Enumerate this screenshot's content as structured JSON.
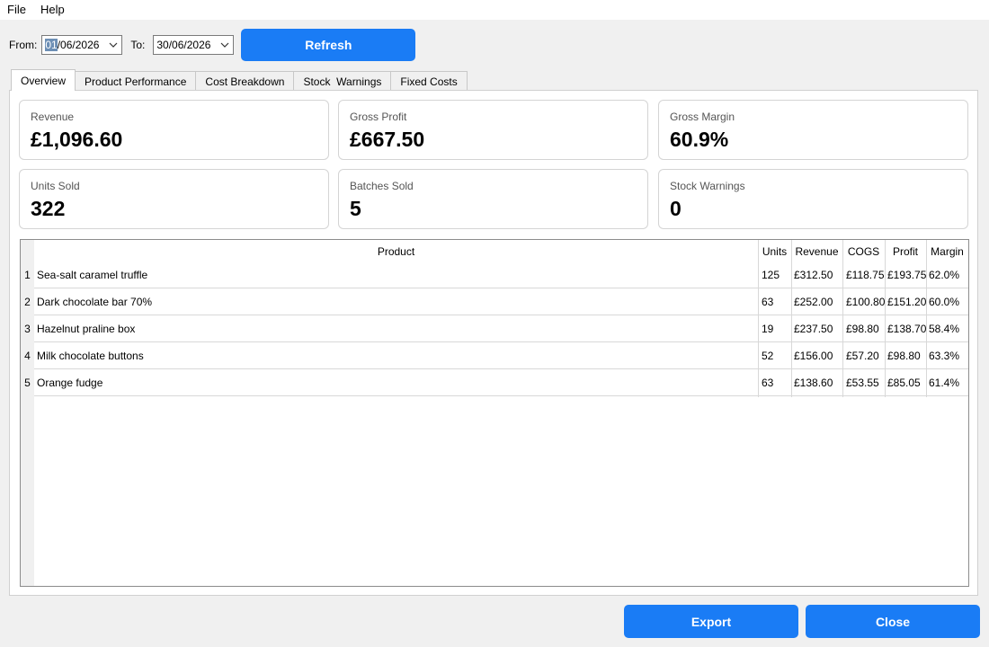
{
  "menu": [
    "File",
    "Help"
  ],
  "filters": {
    "from_label": "From:",
    "from_value_selected": "01",
    "from_value_rest": "/06/2026",
    "to_label": "To:",
    "to_value": "30/06/2026"
  },
  "refresh_label": "Refresh",
  "tabs": [
    "Overview",
    "Product Performance",
    "Cost Breakdown",
    "Stock  Warnings",
    "Fixed Costs"
  ],
  "active_tab": "Overview",
  "cards": [
    {
      "title": "Revenue",
      "value": "£1,096.60"
    },
    {
      "title": "Gross Profit",
      "value": "£667.50"
    },
    {
      "title": "Gross Margin",
      "value": "60.9%"
    },
    {
      "title": "Units Sold",
      "value": "322"
    },
    {
      "title": "Batches Sold",
      "value": "5"
    },
    {
      "title": "Stock Warnings",
      "value": "0"
    }
  ],
  "table": {
    "headers": [
      "Product",
      "Units",
      "Revenue",
      "COGS",
      "Profit",
      "Margin"
    ],
    "rows": [
      {
        "num": "1",
        "product": "Sea-salt caramel truffle",
        "units": "125",
        "revenue": "£312.50",
        "cogs": "£118.75",
        "profit": "£193.75",
        "margin": "62.0%"
      },
      {
        "num": "2",
        "product": "Dark chocolate bar 70%",
        "units": "63",
        "revenue": "£252.00",
        "cogs": "£100.80",
        "profit": "£151.20",
        "margin": "60.0%"
      },
      {
        "num": "3",
        "product": "Hazelnut praline box",
        "units": "19",
        "revenue": "£237.50",
        "cogs": "£98.80",
        "profit": "£138.70",
        "margin": "58.4%"
      },
      {
        "num": "4",
        "product": "Milk chocolate buttons",
        "units": "52",
        "revenue": "£156.00",
        "cogs": "£57.20",
        "profit": "£98.80",
        "margin": "63.3%"
      },
      {
        "num": "5",
        "product": "Orange fudge",
        "units": "63",
        "revenue": "£138.60",
        "cogs": "£53.55",
        "profit": "£85.05",
        "margin": "61.4%"
      }
    ]
  },
  "buttons": {
    "export": "Export",
    "close": "Close"
  },
  "colors": {
    "accent": "#1a7cf5",
    "selection": "#6d8fb5"
  }
}
